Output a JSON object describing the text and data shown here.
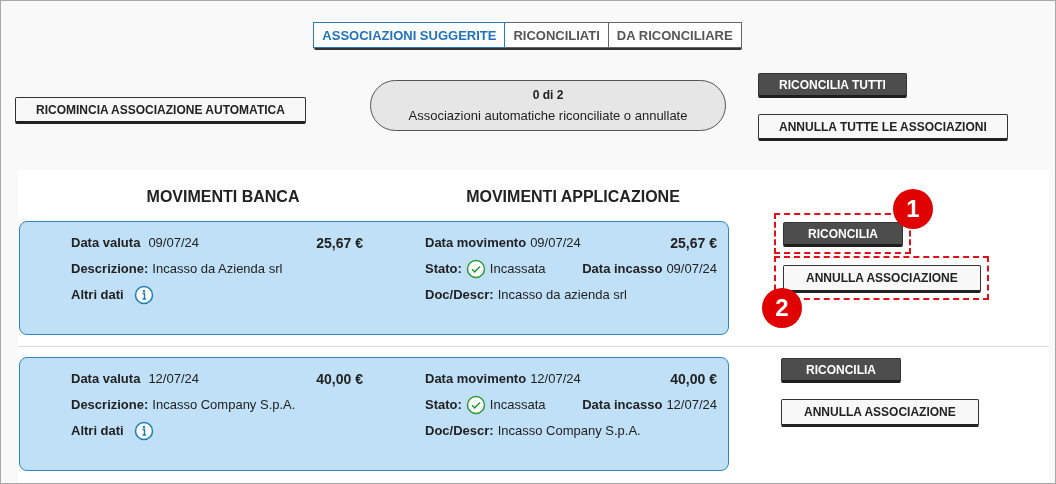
{
  "tabs": [
    {
      "label": "ASSOCIAZIONI SUGGERITE",
      "selected": true
    },
    {
      "label": "RICONCILIATI",
      "selected": false
    },
    {
      "label": "DA RICONCILIARE",
      "selected": false
    }
  ],
  "restart_button": "RICOMINCIA ASSOCIAZIONE AUTOMATICA",
  "progress": {
    "count": "0 di 2",
    "caption": "Associazioni automatiche riconciliate o annullate"
  },
  "bulk_actions": [
    {
      "label": "RICONCILIA TUTTI",
      "kind": "primary"
    },
    {
      "label": "ANNULLA TUTTE LE ASSOCIAZIONI",
      "kind": "secondary"
    }
  ],
  "columns": [
    "MOVIMENTI BANCA",
    "MOVIMENTI APPLICAZIONE"
  ],
  "matches": [
    {
      "bank": {
        "date_label": "Data valuta",
        "date": "09/07/24",
        "amount": "25,67 €",
        "description_label": "Descrizione:",
        "description": "Incasso da Azienda srl",
        "other_label": "Altri dati"
      },
      "app": {
        "date_label": "Data movimento",
        "date": "09/07/24",
        "amount": "25,67 €",
        "status_label": "Stato:",
        "status": "Incassata",
        "cashed_label": "Data incasso",
        "cashed_date": "09/07/24",
        "doc_label": "Doc/Descr:",
        "doc": "Incasso da azienda srl"
      },
      "actions": [
        {
          "label": "RICONCILIA",
          "kind": "primary",
          "callout": "1"
        },
        {
          "label": "ANNULLA ASSOCIAZIONE",
          "kind": "secondary",
          "callout": "2"
        }
      ]
    },
    {
      "bank": {
        "date_label": "Data valuta",
        "date": "12/07/24",
        "amount": "40,00 €",
        "description_label": "Descrizione:",
        "description": "Incasso Company S.p.A.",
        "other_label": "Altri dati"
      },
      "app": {
        "date_label": "Data movimento",
        "date": "12/07/24",
        "amount": "40,00 €",
        "status_label": "Stato:",
        "status": "Incassata",
        "cashed_label": "Data incasso",
        "cashed_date": "12/07/24",
        "doc_label": "Doc/Descr:",
        "doc": "Incasso Company S.p.A."
      },
      "actions": [
        {
          "label": "RICONCILIA",
          "kind": "primary"
        },
        {
          "label": "ANNULLA ASSOCIAZIONE",
          "kind": "secondary"
        }
      ]
    }
  ]
}
